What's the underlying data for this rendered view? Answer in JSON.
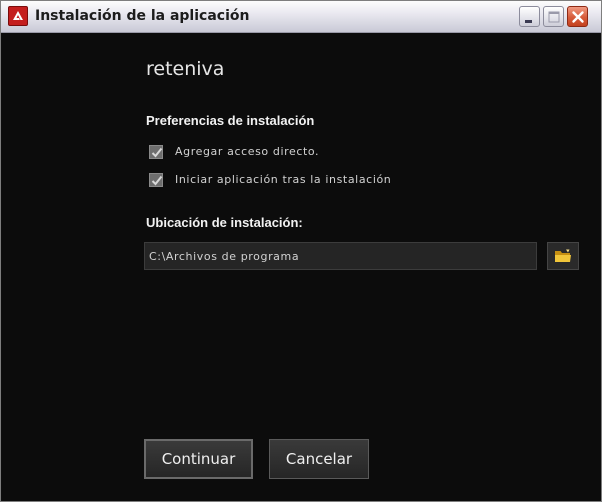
{
  "window": {
    "title": "Instalación de la aplicación"
  },
  "app": {
    "name": "reteniva"
  },
  "preferences": {
    "heading": "Preferencias de instalación",
    "options": [
      {
        "label": "Agregar acceso directo.",
        "checked": true
      },
      {
        "label": "Iniciar aplicación tras la instalación",
        "checked": true
      }
    ]
  },
  "location": {
    "heading": "Ubicación de instalación:",
    "path_value": "C:\\Archivos de programa",
    "browse_icon": "folder-icon"
  },
  "actions": {
    "continue_label": "Continuar",
    "cancel_label": "Cancelar"
  },
  "colors": {
    "background": "#0c0c0c",
    "text": "#d2d2d2",
    "accent_folder": "#e8b323",
    "close_button": "#d65b3a"
  }
}
